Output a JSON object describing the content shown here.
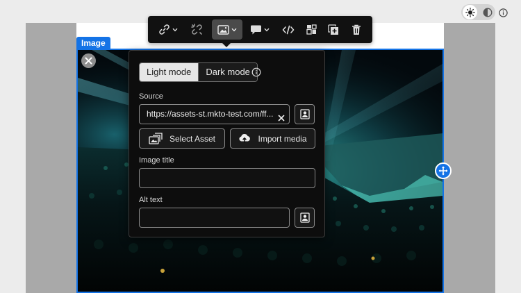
{
  "editor": {
    "block_type_label": "Image"
  },
  "toolbar": {
    "tools": [
      {
        "name": "link",
        "icon": "link-icon",
        "has_menu": true
      },
      {
        "name": "unlink",
        "icon": "unlink-icon",
        "has_menu": false
      },
      {
        "name": "image",
        "icon": "image-icon",
        "has_menu": true,
        "active": true
      },
      {
        "name": "comment",
        "icon": "comment-icon",
        "has_menu": true
      },
      {
        "name": "code",
        "icon": "code-icon",
        "has_menu": false
      },
      {
        "name": "layout",
        "icon": "grid-icon",
        "has_menu": false
      },
      {
        "name": "duplicate",
        "icon": "duplicate-icon",
        "has_menu": false
      },
      {
        "name": "delete",
        "icon": "trash-icon",
        "has_menu": false
      }
    ]
  },
  "image_panel": {
    "mode_light_label": "Light mode",
    "mode_dark_label": "Dark mode",
    "selected_mode": "Light mode",
    "source_label": "Source",
    "source_value": "https://assets-st.mkto-test.com/ff...",
    "select_asset_label": "Select Asset",
    "import_media_label": "Import media",
    "image_title_label": "Image title",
    "image_title_value": "",
    "alt_text_label": "Alt text",
    "alt_text_value": ""
  },
  "colors": {
    "accent": "#1473e6",
    "toolbar_bg": "#111111",
    "panel_bg": "#0d0d0d"
  }
}
